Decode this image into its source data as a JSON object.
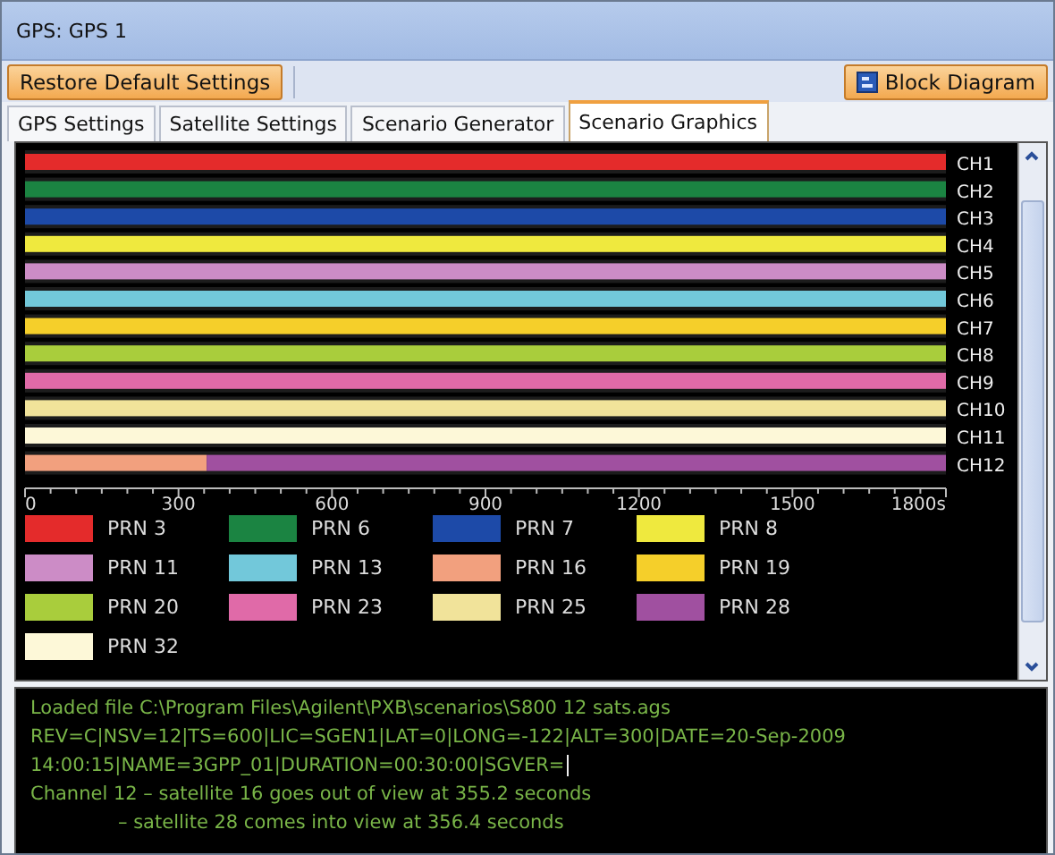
{
  "window": {
    "title": "GPS: GPS 1"
  },
  "toolbar": {
    "buttons": [
      {
        "label": "Restore Default Settings",
        "kind": "text"
      },
      {
        "label": "Block Diagram",
        "kind": "icon"
      }
    ]
  },
  "tabs": [
    {
      "label": "GPS Settings",
      "selected": false
    },
    {
      "label": "Satellite Settings",
      "selected": false
    },
    {
      "label": "Scenario Generator",
      "selected": false
    },
    {
      "label": "Scenario Graphics",
      "selected": true
    }
  ],
  "chart_data": {
    "type": "bar",
    "orientation": "horizontal",
    "stacked": true,
    "categories": [
      "CH1",
      "CH2",
      "CH3",
      "CH4",
      "CH5",
      "CH6",
      "CH7",
      "CH8",
      "CH9",
      "CH10",
      "CH11",
      "CH12"
    ],
    "xlim": [
      0,
      1800
    ],
    "xticks": [
      0,
      300,
      600,
      900,
      1200,
      1500,
      {
        "value": 1800,
        "label": "1800s"
      }
    ],
    "series": [
      {
        "name": "PRN 3",
        "color": "#e42b2b",
        "values": [
          1800,
          null,
          null,
          null,
          null,
          null,
          null,
          null,
          null,
          null,
          null,
          null
        ]
      },
      {
        "name": "PRN 6",
        "color": "#1b8442",
        "values": [
          null,
          1800,
          null,
          null,
          null,
          null,
          null,
          null,
          null,
          null,
          null,
          null
        ]
      },
      {
        "name": "PRN 7",
        "color": "#1d4aa8",
        "values": [
          null,
          null,
          1800,
          null,
          null,
          null,
          null,
          null,
          null,
          null,
          null,
          null
        ]
      },
      {
        "name": "PRN 8",
        "color": "#efe93e",
        "values": [
          null,
          null,
          null,
          1800,
          null,
          null,
          null,
          null,
          null,
          null,
          null,
          null
        ]
      },
      {
        "name": "PRN 11",
        "color": "#cc8cc6",
        "values": [
          null,
          null,
          null,
          null,
          1800,
          null,
          null,
          null,
          null,
          null,
          null,
          null
        ]
      },
      {
        "name": "PRN 13",
        "color": "#72c8da",
        "values": [
          null,
          null,
          null,
          null,
          null,
          1800,
          null,
          null,
          null,
          null,
          null,
          null
        ]
      },
      {
        "name": "PRN 16",
        "color": "#f2a07e",
        "values": [
          null,
          null,
          null,
          null,
          null,
          null,
          null,
          null,
          null,
          null,
          null,
          355
        ]
      },
      {
        "name": "PRN 19",
        "color": "#f5cf2a",
        "values": [
          null,
          null,
          null,
          null,
          null,
          null,
          1800,
          null,
          null,
          null,
          null,
          null
        ]
      },
      {
        "name": "PRN 20",
        "color": "#a9cd3c",
        "values": [
          null,
          null,
          null,
          null,
          null,
          null,
          null,
          1800,
          null,
          null,
          null,
          null
        ]
      },
      {
        "name": "PRN 23",
        "color": "#e06aa8",
        "values": [
          null,
          null,
          null,
          null,
          null,
          null,
          null,
          null,
          1800,
          null,
          null,
          null
        ]
      },
      {
        "name": "PRN 25",
        "color": "#f1e39a",
        "values": [
          null,
          null,
          null,
          null,
          null,
          null,
          null,
          null,
          null,
          1800,
          null,
          null
        ]
      },
      {
        "name": "PRN 28",
        "color": "#a050a0",
        "values": [
          null,
          null,
          null,
          null,
          null,
          null,
          null,
          null,
          null,
          null,
          null,
          1445
        ]
      },
      {
        "name": "PRN 32",
        "color": "#fdf8d8",
        "values": [
          null,
          null,
          null,
          null,
          null,
          null,
          null,
          null,
          null,
          null,
          1800,
          null
        ]
      }
    ]
  },
  "log": {
    "lines": [
      {
        "text": "Loaded file C:\\Program Files\\Agilent\\PXB\\scenarios\\S800 12 sats.ags",
        "caret": false
      },
      {
        "text": "REV=C|NSV=12|TS=600|LIC=SGEN1|LAT=0|LONG=-122|ALT=300|DATE=20-Sep-2009",
        "caret": false
      },
      {
        "text": "14:00:15|NAME=3GPP_01|DURATION=00:30:00|SGVER=",
        "caret": true
      },
      {
        "text": "Channel 12 – satellite 16 goes out of view at 355.2 seconds",
        "caret": false,
        "children": [
          {
            "text": "– satellite 28 comes into view at 356.4 seconds",
            "caret": false
          }
        ]
      }
    ]
  }
}
